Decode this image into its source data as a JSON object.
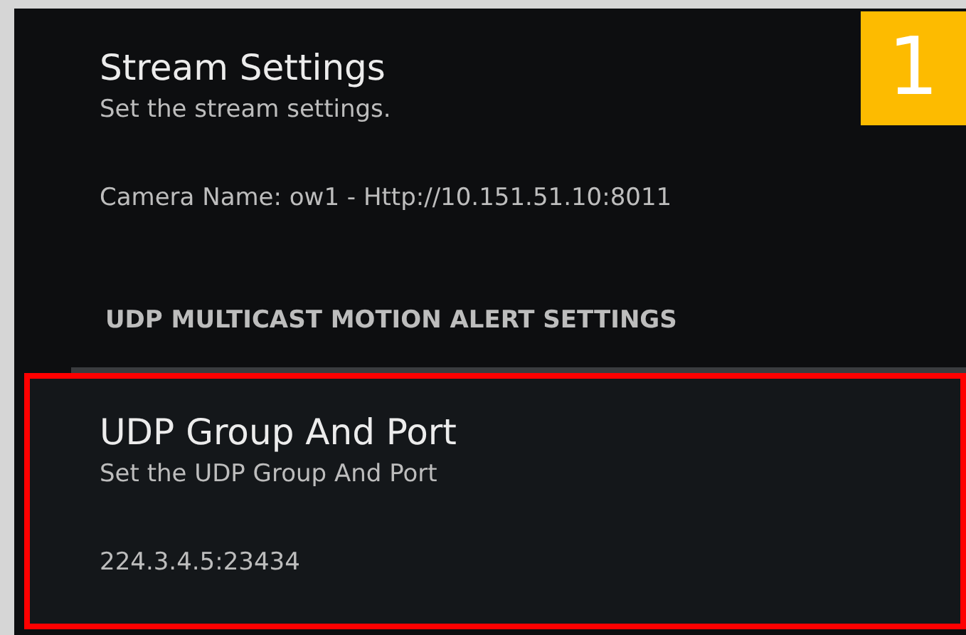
{
  "badge": "1",
  "items": [
    {
      "kind": "preference",
      "title": "Stream Settings",
      "summary": "Set the stream settings.",
      "value": "Camera Name: ow1 - Http://10.151.51.10:8011",
      "highlighted": false
    },
    {
      "kind": "category",
      "title": "UDP MULTICAST MOTION ALERT SETTINGS",
      "highlighted": false
    },
    {
      "kind": "preference",
      "title": "UDP Group And Port",
      "summary": "Set the UDP Group And Port",
      "value": "224.3.4.5:23434",
      "highlighted": true
    }
  ]
}
